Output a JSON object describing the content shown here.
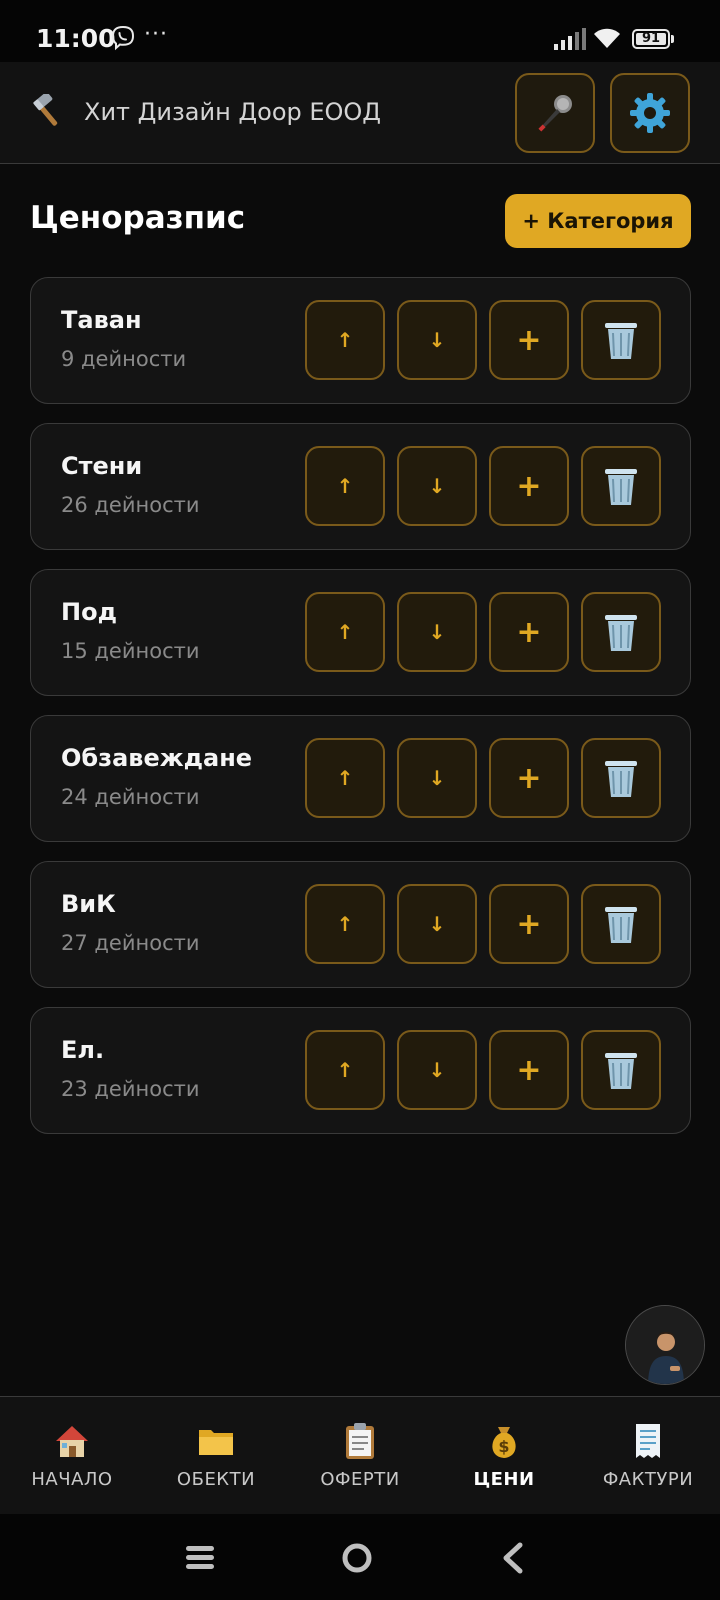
{
  "status_bar": {
    "time": "11:00",
    "dots": "···",
    "battery": "91",
    "icons": [
      "viber-icon",
      "signal-icon",
      "wifi-icon",
      "battery-icon"
    ]
  },
  "header": {
    "title": "Хит Дизайн Доор ЕООД",
    "logo_icon": "hammer-icon",
    "mic_icon": "microphone-icon",
    "settings_icon": "gear-icon"
  },
  "page": {
    "title": "Ценоразпис",
    "add_category_label": "+ Категория"
  },
  "categories": [
    {
      "name": "Таван",
      "count": "9 дейности"
    },
    {
      "name": "Стени",
      "count": "26 дейности"
    },
    {
      "name": "Под",
      "count": "15 дейности"
    },
    {
      "name": "Обзавеждане",
      "count": "24 дейности"
    },
    {
      "name": "ВиК",
      "count": "27 дейности"
    },
    {
      "name": "Ел.",
      "count": "23 дейности"
    }
  ],
  "card_actions": {
    "up": "↑",
    "down": "↓",
    "add": "+"
  },
  "bottom_nav": {
    "items": [
      {
        "label": "НАЧАЛО",
        "icon": "house-icon"
      },
      {
        "label": "ОБЕКТИ",
        "icon": "folder-icon"
      },
      {
        "label": "ОФЕРТИ",
        "icon": "clipboard-icon"
      },
      {
        "label": "ЦЕНИ",
        "icon": "money-bag-icon",
        "active": true
      },
      {
        "label": "ФАКТУРИ",
        "icon": "receipt-icon"
      }
    ]
  },
  "colors": {
    "accent": "#e0a823",
    "background": "#0b0b0b",
    "card": "#141414",
    "button_border": "#7a5a1a"
  }
}
